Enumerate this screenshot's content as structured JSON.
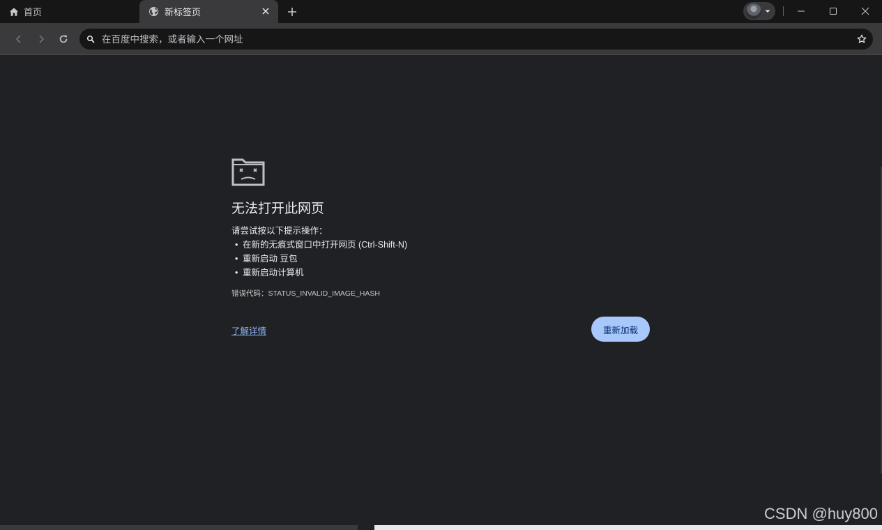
{
  "tabs": [
    {
      "label": "首页",
      "icon": "home-icon"
    },
    {
      "label": "新标签页",
      "icon": "globe-icon",
      "active": true
    }
  ],
  "tab_close_icon": "close-icon",
  "new_tab_icon": "plus-icon",
  "window_controls": {
    "minimize_icon": "minimize-icon",
    "maximize_icon": "maximize-icon",
    "close_icon": "close-icon"
  },
  "nav": {
    "back_icon": "back-arrow-icon",
    "forward_icon": "forward-arrow-icon",
    "reload_icon": "reload-icon"
  },
  "omnibox": {
    "placeholder": "在百度中搜索，或者输入一个网址",
    "value": ""
  },
  "error": {
    "title": "无法打开此网页",
    "suggest_label": "请尝试按以下提示操作：",
    "suggestions": [
      "在新的无痕式窗口中打开网页 (Ctrl-Shift-N)",
      "重新启动 豆包",
      "重新启动计算机"
    ],
    "code_line": "错误代码：STATUS_INVALID_IMAGE_HASH",
    "details_link": "了解详情",
    "reload_button": "重新加载"
  },
  "watermark": "CSDN @huy800",
  "colors": {
    "background": "#202124",
    "tabstrip": "#161616",
    "toolbar": "#3a3a3c",
    "link": "#8ab4f8",
    "reload_button": "#a8c7fa"
  }
}
